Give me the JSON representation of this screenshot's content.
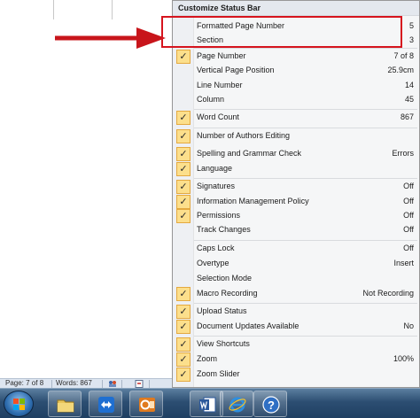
{
  "menu": {
    "title": "Customize Status Bar",
    "items": [
      {
        "label": "Formatted Page Number",
        "value": "5",
        "checked": false
      },
      {
        "label": "Section",
        "value": "3",
        "checked": false
      },
      {
        "label": "Page Number",
        "value": "7 of 8",
        "checked": true
      },
      {
        "label": "Vertical Page Position",
        "value": "25.9cm",
        "checked": false
      },
      {
        "label": "Line Number",
        "value": "14",
        "checked": false
      },
      {
        "label": "Column",
        "value": "45",
        "checked": false
      },
      {
        "label": "Word Count",
        "value": "867",
        "checked": true
      },
      {
        "label": "Number of Authors Editing",
        "value": "",
        "checked": true
      },
      {
        "label": "Spelling and Grammar Check",
        "value": "Errors",
        "checked": true
      },
      {
        "label": "Language",
        "value": "",
        "checked": true
      },
      {
        "label": "Signatures",
        "value": "Off",
        "checked": true
      },
      {
        "label": "Information Management Policy",
        "value": "Off",
        "checked": true
      },
      {
        "label": "Permissions",
        "value": "Off",
        "checked": true
      },
      {
        "label": "Track Changes",
        "value": "Off",
        "checked": false
      },
      {
        "label": "Caps Lock",
        "value": "Off",
        "checked": false
      },
      {
        "label": "Overtype",
        "value": "Insert",
        "checked": false
      },
      {
        "label": "Selection Mode",
        "value": "",
        "checked": false
      },
      {
        "label": "Macro Recording",
        "value": "Not Recording",
        "checked": true
      },
      {
        "label": "Upload Status",
        "value": "",
        "checked": true
      },
      {
        "label": "Document Updates Available",
        "value": "No",
        "checked": true
      },
      {
        "label": "View Shortcuts",
        "value": "",
        "checked": true
      },
      {
        "label": "Zoom",
        "value": "100%",
        "checked": true
      },
      {
        "label": "Zoom Slider",
        "value": "",
        "checked": true
      }
    ]
  },
  "statusbar": {
    "page": "Page: 7 of 8",
    "words": "Words: 867"
  },
  "check_glyph": "✓",
  "colors": {
    "highlight_box": "#d6141e",
    "arrow": "#c8151b",
    "check_bg": "#fcdf8c",
    "taskbar": "#2c4e72"
  },
  "taskbar": {
    "items": [
      "start-orb",
      "folder-icon",
      "remote-support-icon",
      "outlook-icon",
      "word-icon",
      "internet-explorer-icon",
      "help-icon"
    ]
  }
}
